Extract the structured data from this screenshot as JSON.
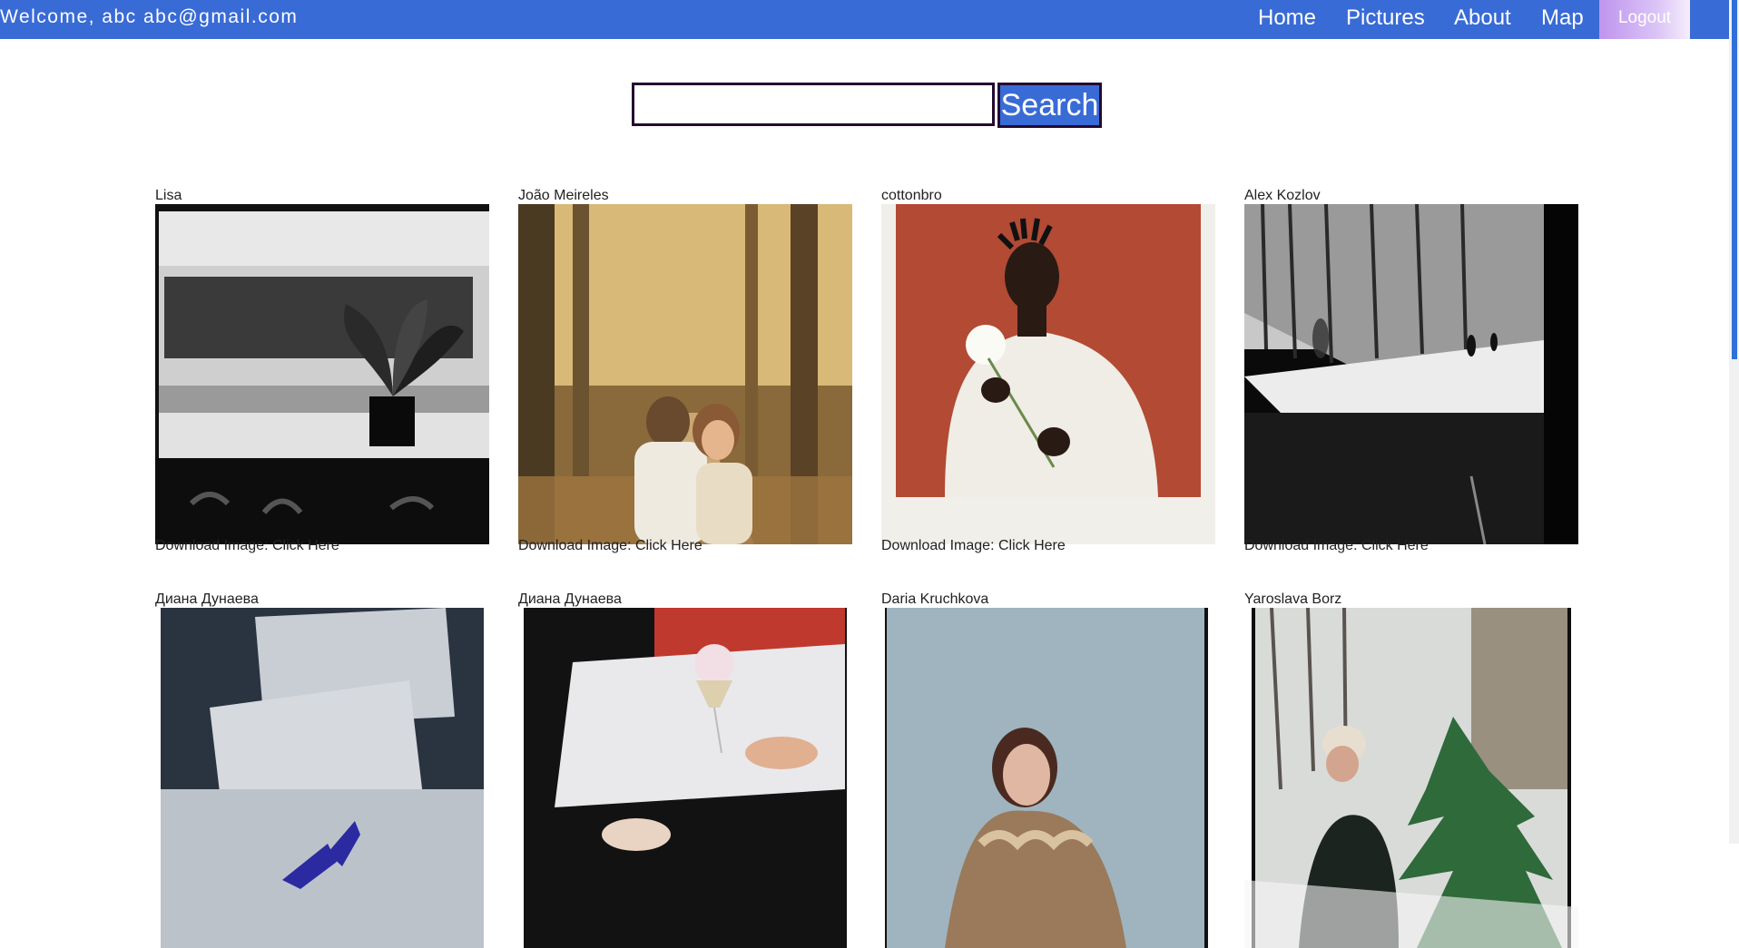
{
  "header": {
    "welcome": "Welcome, abc abc@gmail.com",
    "nav": [
      {
        "label": "Home"
      },
      {
        "label": "Pictures"
      },
      {
        "label": "About"
      },
      {
        "label": "Map"
      }
    ],
    "logout": "Logout",
    "accent_color": "#396bd6"
  },
  "search": {
    "value": "",
    "placeholder": "",
    "button_label": "Search"
  },
  "gallery": {
    "download_prefix": "Download Image: ",
    "download_link": "Click Here",
    "items": [
      {
        "author": "Lisa",
        "subject": "black-and-white potted plant on window sill"
      },
      {
        "author": "João Meireles",
        "subject": "couple embracing on forest path"
      },
      {
        "author": "cottonbro",
        "subject": "polaroid portrait of man holding white flower"
      },
      {
        "author": "Alex Kozlov",
        "subject": "black-and-white park alley with pedestrians"
      },
      {
        "author": "Диана Дунаева",
        "subject": "blue heels on white pillows"
      },
      {
        "author": "Диана Дунаева",
        "subject": "champagne glass with cotton candy"
      },
      {
        "author": "Daria Kruchkova",
        "subject": "woman in fur coat against blue wall"
      },
      {
        "author": "Yaroslava Borz",
        "subject": "woman carrying christmas tree in snow"
      }
    ]
  }
}
